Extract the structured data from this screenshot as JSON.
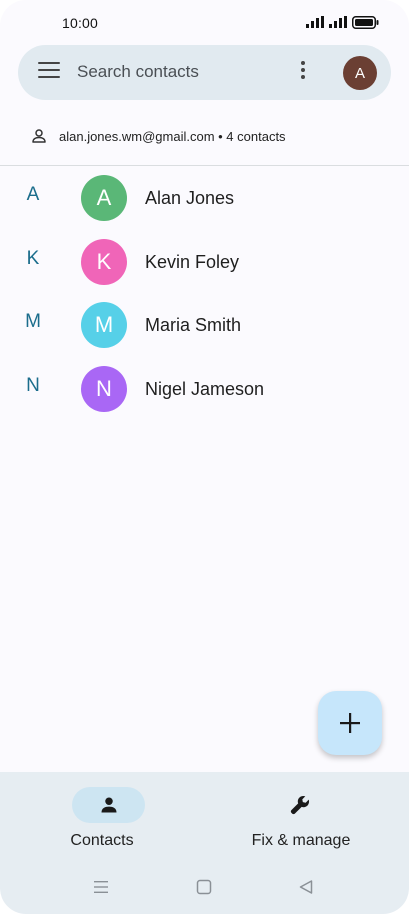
{
  "status_bar": {
    "time": "10:00"
  },
  "search": {
    "placeholder": "Search contacts",
    "avatar_letter": "A"
  },
  "account": {
    "summary": "alan.jones.wm@gmail.com • 4 contacts"
  },
  "contacts": [
    {
      "section": "A",
      "initial": "A",
      "name": "Alan Jones",
      "color": "#5ab777"
    },
    {
      "section": "K",
      "initial": "K",
      "name": "Kevin Foley",
      "color": "#f065b8"
    },
    {
      "section": "M",
      "initial": "M",
      "name": "Maria Smith",
      "color": "#56d0e8"
    },
    {
      "section": "N",
      "initial": "N",
      "name": "Nigel Jameson",
      "color": "#a967f5"
    }
  ],
  "colors": {
    "accent": "#1b6d8c",
    "fab": "#c6e6fb",
    "search_bg": "#e1eaf0",
    "nav_bg": "#e6edf2",
    "avatar_bg": "#6b3f33"
  },
  "bottom_nav": {
    "contacts_label": "Contacts",
    "fix_label": "Fix & manage"
  },
  "icons": {
    "menu": "menu-icon",
    "more": "more-vert-icon",
    "person": "person-icon",
    "add": "plus-icon",
    "wrench": "wrench-icon"
  }
}
